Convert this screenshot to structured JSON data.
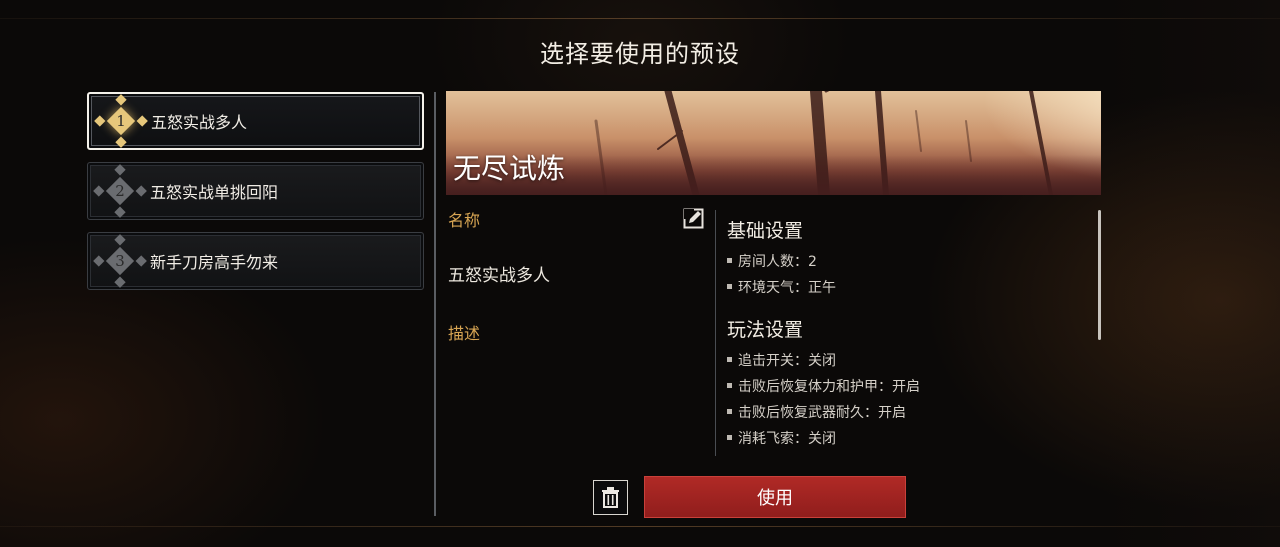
{
  "dialog": {
    "title": "选择要使用的预设"
  },
  "presets": [
    {
      "index": "1",
      "label": "五怒实战多人",
      "selected": true
    },
    {
      "index": "2",
      "label": "五怒实战单挑回阳",
      "selected": false
    },
    {
      "index": "3",
      "label": "新手刀房高手勿来",
      "selected": false
    }
  ],
  "detail": {
    "mode_title": "无尽试炼",
    "name_label": "名称",
    "name_value": "五怒实战多人",
    "desc_label": "描述",
    "basic_title": "基础设置",
    "basic_items": [
      "房间人数：2",
      "环境天气：正午"
    ],
    "play_title": "玩法设置",
    "play_items": [
      "追击开关：关闭",
      "击败后恢复体力和护甲：开启",
      "击败后恢复武器耐久：开启",
      "消耗飞索：关闭"
    ]
  },
  "actions": {
    "use_label": "使用",
    "delete_icon": "trash-icon",
    "edit_icon": "edit-icon"
  },
  "colors": {
    "accent_gold": "#d7a553",
    "use_red": "#a52422",
    "selected_badge": "#e6c77b"
  }
}
